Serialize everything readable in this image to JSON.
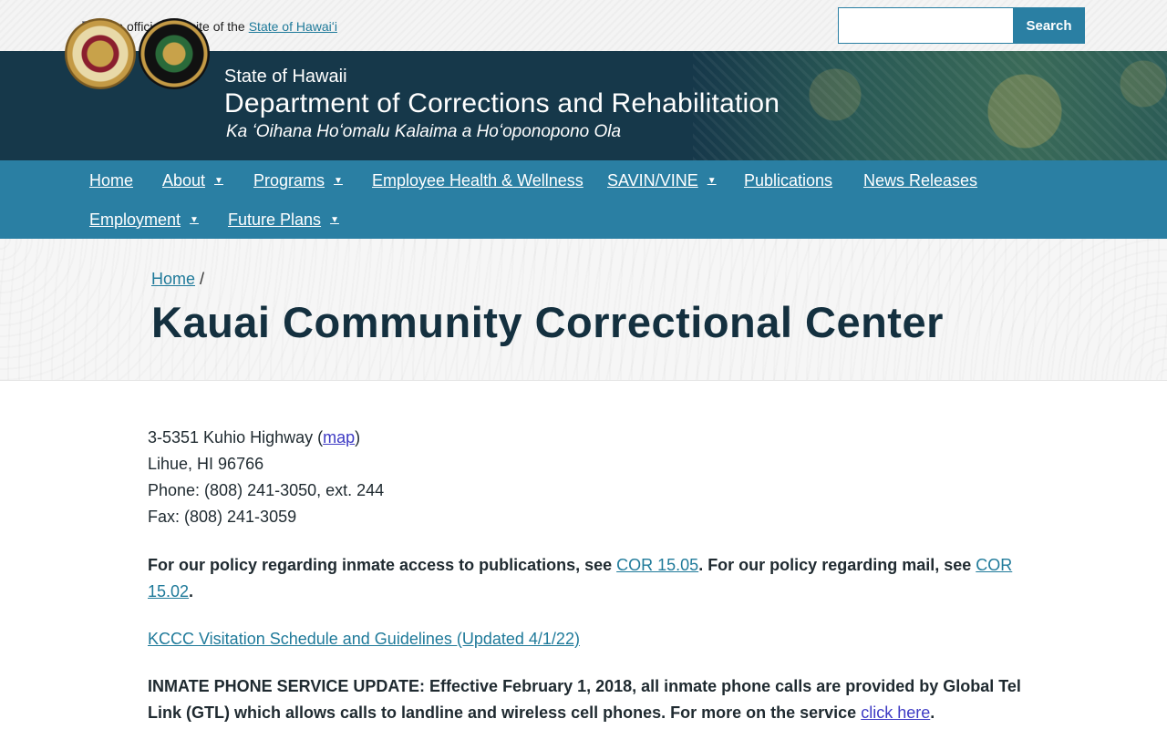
{
  "topbar": {
    "official_prefix": "An official website of the",
    "official_link": "State of Hawaiʻi",
    "search_placeholder": "",
    "search_button": "Search"
  },
  "header": {
    "state_name": "State of Hawaii",
    "dept_name": "Department of Corrections and Rehabilitation",
    "motto": "Ka ʻOihana Hoʻomalu Kalaima a Hoʻoponopono Ola"
  },
  "nav": {
    "items": [
      {
        "label": "Home",
        "dropdown": false
      },
      {
        "label": "About",
        "dropdown": true
      },
      {
        "label": "Programs",
        "dropdown": true
      },
      {
        "label": "Employee Health & Wellness",
        "dropdown": false
      },
      {
        "label": "SAVIN/VINE",
        "dropdown": true
      },
      {
        "label": "Publications",
        "dropdown": false
      },
      {
        "label": "News Releases",
        "dropdown": false
      },
      {
        "label": "Employment",
        "dropdown": true
      },
      {
        "label": "Future Plans",
        "dropdown": true
      }
    ],
    "caret_glyph": "▼"
  },
  "breadcrumb": {
    "home": "Home",
    "separator": "/"
  },
  "page": {
    "title": "Kauai Community Correctional Center"
  },
  "content": {
    "address_street": "3-5351 Kuhio Highway (",
    "map_link": "map",
    "address_close": ")",
    "city": "Lihue, HI 96766",
    "phone": "Phone: (808) 241-3050, ext. 244",
    "fax": "Fax: (808) 241-3059",
    "policy_text_1": "For our policy regarding inmate access to publications, see ",
    "policy_link_1": "COR 15.05",
    "policy_text_2": ". For our policy regarding mail, see ",
    "policy_link_2": "COR 15.02",
    "policy_text_3": ".",
    "visitation_link": "KCCC Visitation Schedule and Guidelines (Updated 4/1/22)",
    "phone_update_text": "INMATE PHONE SERVICE UPDATE: Effective February 1, 2018, all inmate phone calls are provided by Global Tel Link (GTL) which allows calls to landline and wireless cell phones. For more on the service ",
    "phone_update_link": "click here",
    "phone_update_end": "."
  },
  "colors": {
    "accent": "#2a7fa3",
    "banner": "#16384a",
    "link": "#1f7a9a",
    "visited_link": "#3d3ac4"
  }
}
